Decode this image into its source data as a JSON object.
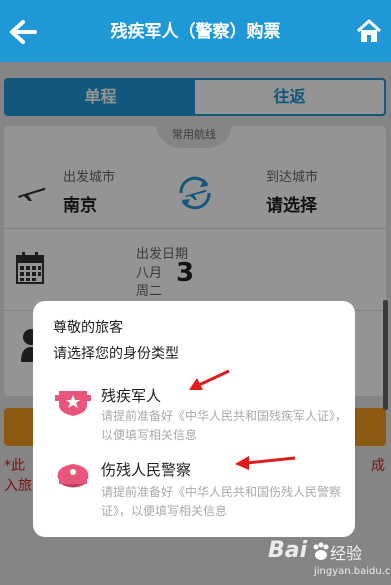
{
  "header": {
    "title": "残疾军人（警察）购票"
  },
  "tabs": {
    "oneway": "单程",
    "round": "往返"
  },
  "route": {
    "common_routes": "常用航线",
    "depart_label": "出发城市",
    "depart_value": "南京",
    "arrive_label": "到达城市",
    "arrive_value": "请选择"
  },
  "date": {
    "label": "出发日期",
    "month": "八月",
    "weekday": "周二",
    "day": "3"
  },
  "notice": {
    "left": "*此入旅",
    "right": "成"
  },
  "dialog": {
    "greeting": "尊敬的旅客",
    "prompt": "请选择您的身份类型",
    "options": [
      {
        "title": "残疾军人",
        "desc": "请提前准备好《中华人民共和国残疾军人证》，以便填写相关信息",
        "icon": "military-badge-icon"
      },
      {
        "title": "伤残人民警察",
        "desc": "请提前准备好《中华人民共和国伤残人民警察证》，以便填写相关信息",
        "icon": "police-cap-icon"
      }
    ]
  },
  "watermark": {
    "brand": "Bai",
    "jingyan": "经验",
    "url": "jingyan.baidu.com"
  },
  "colors": {
    "brand": "#1e98d6",
    "accent": "#f19b1c",
    "alert": "#d91c1c",
    "arrow": "#e01b1b",
    "icon_pink": "#e8557b"
  }
}
